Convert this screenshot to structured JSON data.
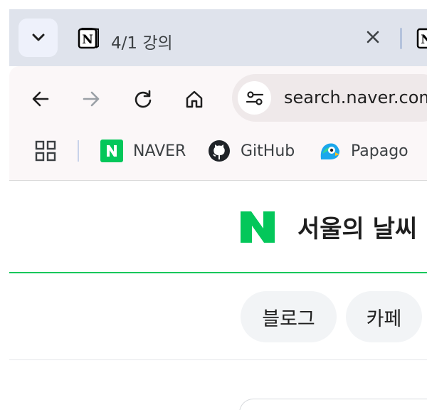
{
  "tabstrip": {
    "tab": {
      "title": "4/1 강의",
      "favicon": "notion-icon"
    }
  },
  "toolbar": {
    "url": "search.naver.com"
  },
  "bookmarks": [
    {
      "label": "NAVER",
      "icon": "naver-icon",
      "color": "#03c75a"
    },
    {
      "label": "GitHub",
      "icon": "github-icon",
      "color": "#1f2328"
    },
    {
      "label": "Papago",
      "icon": "papago-icon",
      "color": "#1aa7ec"
    }
  ],
  "page": {
    "title": "서울의 날씨",
    "accent": "#03c75a",
    "chips": [
      {
        "label": "블로그"
      },
      {
        "label": "카페"
      }
    ]
  }
}
